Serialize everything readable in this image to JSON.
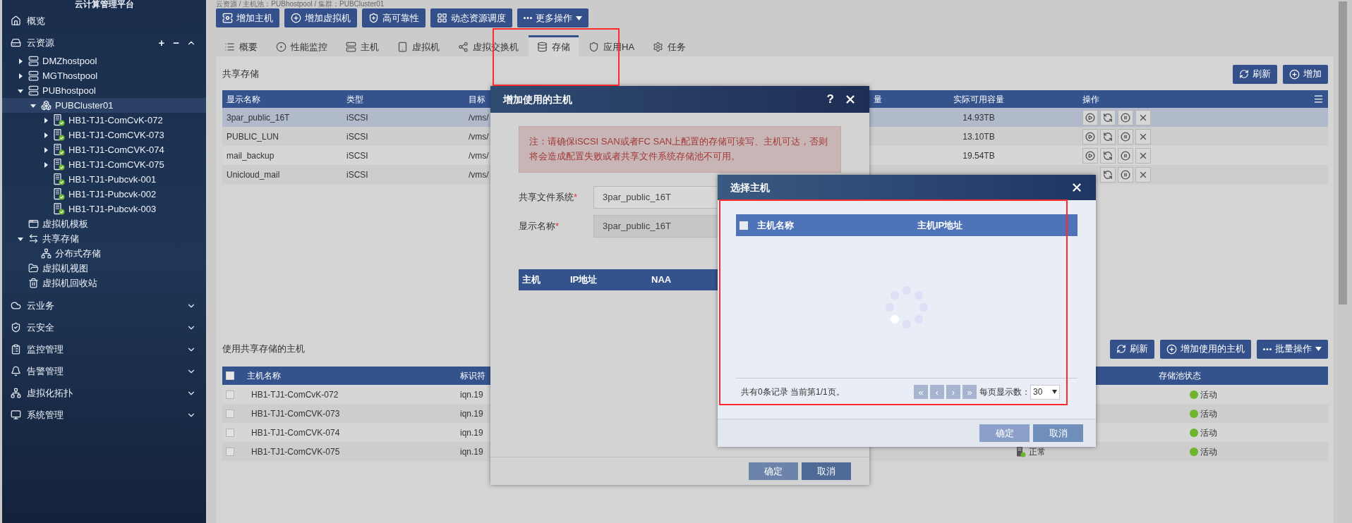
{
  "sidebar": {
    "title": "云计算管理平台",
    "sections": [
      {
        "label": "概览"
      },
      {
        "label": "云资源",
        "expanded": true,
        "tools": [
          "+",
          "−"
        ],
        "children": [
          {
            "label": "DMZhostpool",
            "kind": "pool",
            "expanded": false,
            "selected": false
          },
          {
            "label": "MGThostpool",
            "kind": "pool",
            "expanded": false,
            "selected": false
          },
          {
            "label": "PUBhostpool",
            "kind": "pool",
            "expanded": true,
            "selected": false,
            "children": [
              {
                "label": "PUBCluster01",
                "kind": "cluster",
                "expanded": true,
                "selected": true,
                "children": [
                  {
                    "label": "HB1-TJ1-ComCvK-072",
                    "kind": "host",
                    "expanded": false,
                    "selected": false
                  },
                  {
                    "label": "HB1-TJ1-ComCVK-073",
                    "kind": "host",
                    "expanded": false,
                    "selected": false
                  },
                  {
                    "label": "HB1-TJ1-ComCVK-074",
                    "kind": "host",
                    "expanded": false,
                    "selected": false
                  },
                  {
                    "label": "HB1-TJ1-ComCVK-075",
                    "kind": "host",
                    "expanded": false,
                    "selected": false
                  },
                  {
                    "label": "HB1-TJ1-Pubcvk-001",
                    "kind": "host",
                    "selected": false
                  },
                  {
                    "label": "HB1-TJ1-Pubcvk-002",
                    "kind": "host",
                    "selected": false
                  },
                  {
                    "label": "HB1-TJ1-Pubcvk-003",
                    "kind": "host",
                    "selected": false
                  }
                ]
              }
            ]
          },
          {
            "label": "虚拟机模板",
            "kind": "template",
            "selected": false
          },
          {
            "label": "共享存储",
            "kind": "storage",
            "expanded": true,
            "selected": false,
            "children": [
              {
                "label": "分布式存储",
                "kind": "distributed",
                "selected": false
              }
            ]
          },
          {
            "label": "虚拟机视图",
            "kind": "view",
            "selected": false
          },
          {
            "label": "虚拟机回收站",
            "kind": "recycle",
            "selected": false
          }
        ]
      },
      {
        "label": "云业务",
        "expanded": false
      },
      {
        "label": "云安全",
        "expanded": false
      },
      {
        "label": "监控管理",
        "expanded": false
      },
      {
        "label": "告警管理",
        "expanded": false
      },
      {
        "label": "虚拟化拓扑",
        "expanded": false
      },
      {
        "label": "系统管理",
        "expanded": false
      }
    ]
  },
  "breadcrumb": "云资源 / 主机池：PUBhostpool / 集群：PUBCluster01",
  "toolbar": [
    {
      "label": "增加主机"
    },
    {
      "label": "增加虚拟机"
    },
    {
      "label": "高可靠性"
    },
    {
      "label": "动态资源调度"
    },
    {
      "label": "更多操作",
      "kind": "menu"
    }
  ],
  "tabs": [
    {
      "label": "概要",
      "selected": false
    },
    {
      "label": "性能监控",
      "selected": false
    },
    {
      "label": "主机",
      "selected": false
    },
    {
      "label": "虚拟机",
      "selected": false
    },
    {
      "label": "虚拟交换机",
      "selected": false
    },
    {
      "label": "存储",
      "selected": true
    },
    {
      "label": "应用HA",
      "selected": false
    },
    {
      "label": "任务",
      "selected": false
    }
  ],
  "shared_storage": {
    "title": "共享存储",
    "buttons": [
      "刷新",
      "增加"
    ],
    "columns": [
      "显示名称",
      "类型",
      "目标",
      "量",
      "实际可用容量",
      "操作"
    ],
    "rows": [
      {
        "name": "3par_public_16T",
        "type": "iSCSI",
        "path": "/vms/",
        "capacity": "14.93TB",
        "selected": true
      },
      {
        "name": "PUBLIC_LUN",
        "type": "iSCSI",
        "path": "/vms/",
        "capacity": "13.10TB",
        "selected": false
      },
      {
        "name": "mail_backup",
        "type": "iSCSI",
        "path": "/vms/",
        "capacity": "19.54TB",
        "selected": false
      },
      {
        "name": "Unicloud_mail",
        "type": "iSCSI",
        "path": "/vms/",
        "selected": false
      }
    ]
  },
  "hosts_section": {
    "title": "使用共享存储的主机",
    "buttons": [
      {
        "label": "刷新"
      },
      {
        "label": "增加使用的主机"
      },
      {
        "label": "批量操作",
        "kind": "menu"
      }
    ],
    "columns": [
      "主机名称",
      "标识符",
      "存储池状态"
    ],
    "header_checked": false,
    "rows": [
      {
        "name": "HB1-TJ1-ComCvK-072",
        "id": "iqn.19",
        "pool_status": "活动",
        "checked": false
      },
      {
        "name": "HB1-TJ1-ComCVK-073",
        "id": "iqn.19",
        "pool_status": "活动",
        "checked": false
      },
      {
        "name": "HB1-TJ1-ComCVK-074",
        "id": "iqn.19",
        "pool_status": "活动",
        "checked": false
      },
      {
        "name": "HB1-TJ1-ComCVK-075",
        "id": "iqn.19",
        "host_status": "正常",
        "pool_status": "活动",
        "checked": false
      }
    ]
  },
  "add_host_dialog": {
    "title": "增加使用的主机",
    "help": "?",
    "required_mark": "*",
    "notice": "注：请确保iSCSI SAN或者FC SAN上配置的存储可读写、主机可达，否则将会造成配置失败或者共享文件系统存储池不可用。",
    "fields": [
      {
        "label": "共享文件系统",
        "required": true,
        "value": "3par_public_16T",
        "disabled": false
      },
      {
        "label": "显示名称",
        "required": true,
        "value": "3par_public_16T",
        "disabled": true
      }
    ],
    "columns": [
      "主机",
      "IP地址",
      "NAA"
    ],
    "buttons": [
      {
        "label": "确定",
        "disabled": true
      },
      {
        "label": "取消",
        "disabled": false
      }
    ]
  },
  "select_host_dialog": {
    "title": "选择主机",
    "header_checked": false,
    "columns": [
      "主机名称",
      "主机IP地址"
    ],
    "loading": true,
    "summary": "共有0条记录 当前第1/1页。",
    "pager": [
      "«",
      "‹",
      "›",
      "»"
    ],
    "page_size_label": "每页显示数：",
    "page_size": "30",
    "buttons": [
      {
        "label": "确定",
        "disabled": true
      },
      {
        "label": "取消",
        "disabled": false
      }
    ]
  }
}
